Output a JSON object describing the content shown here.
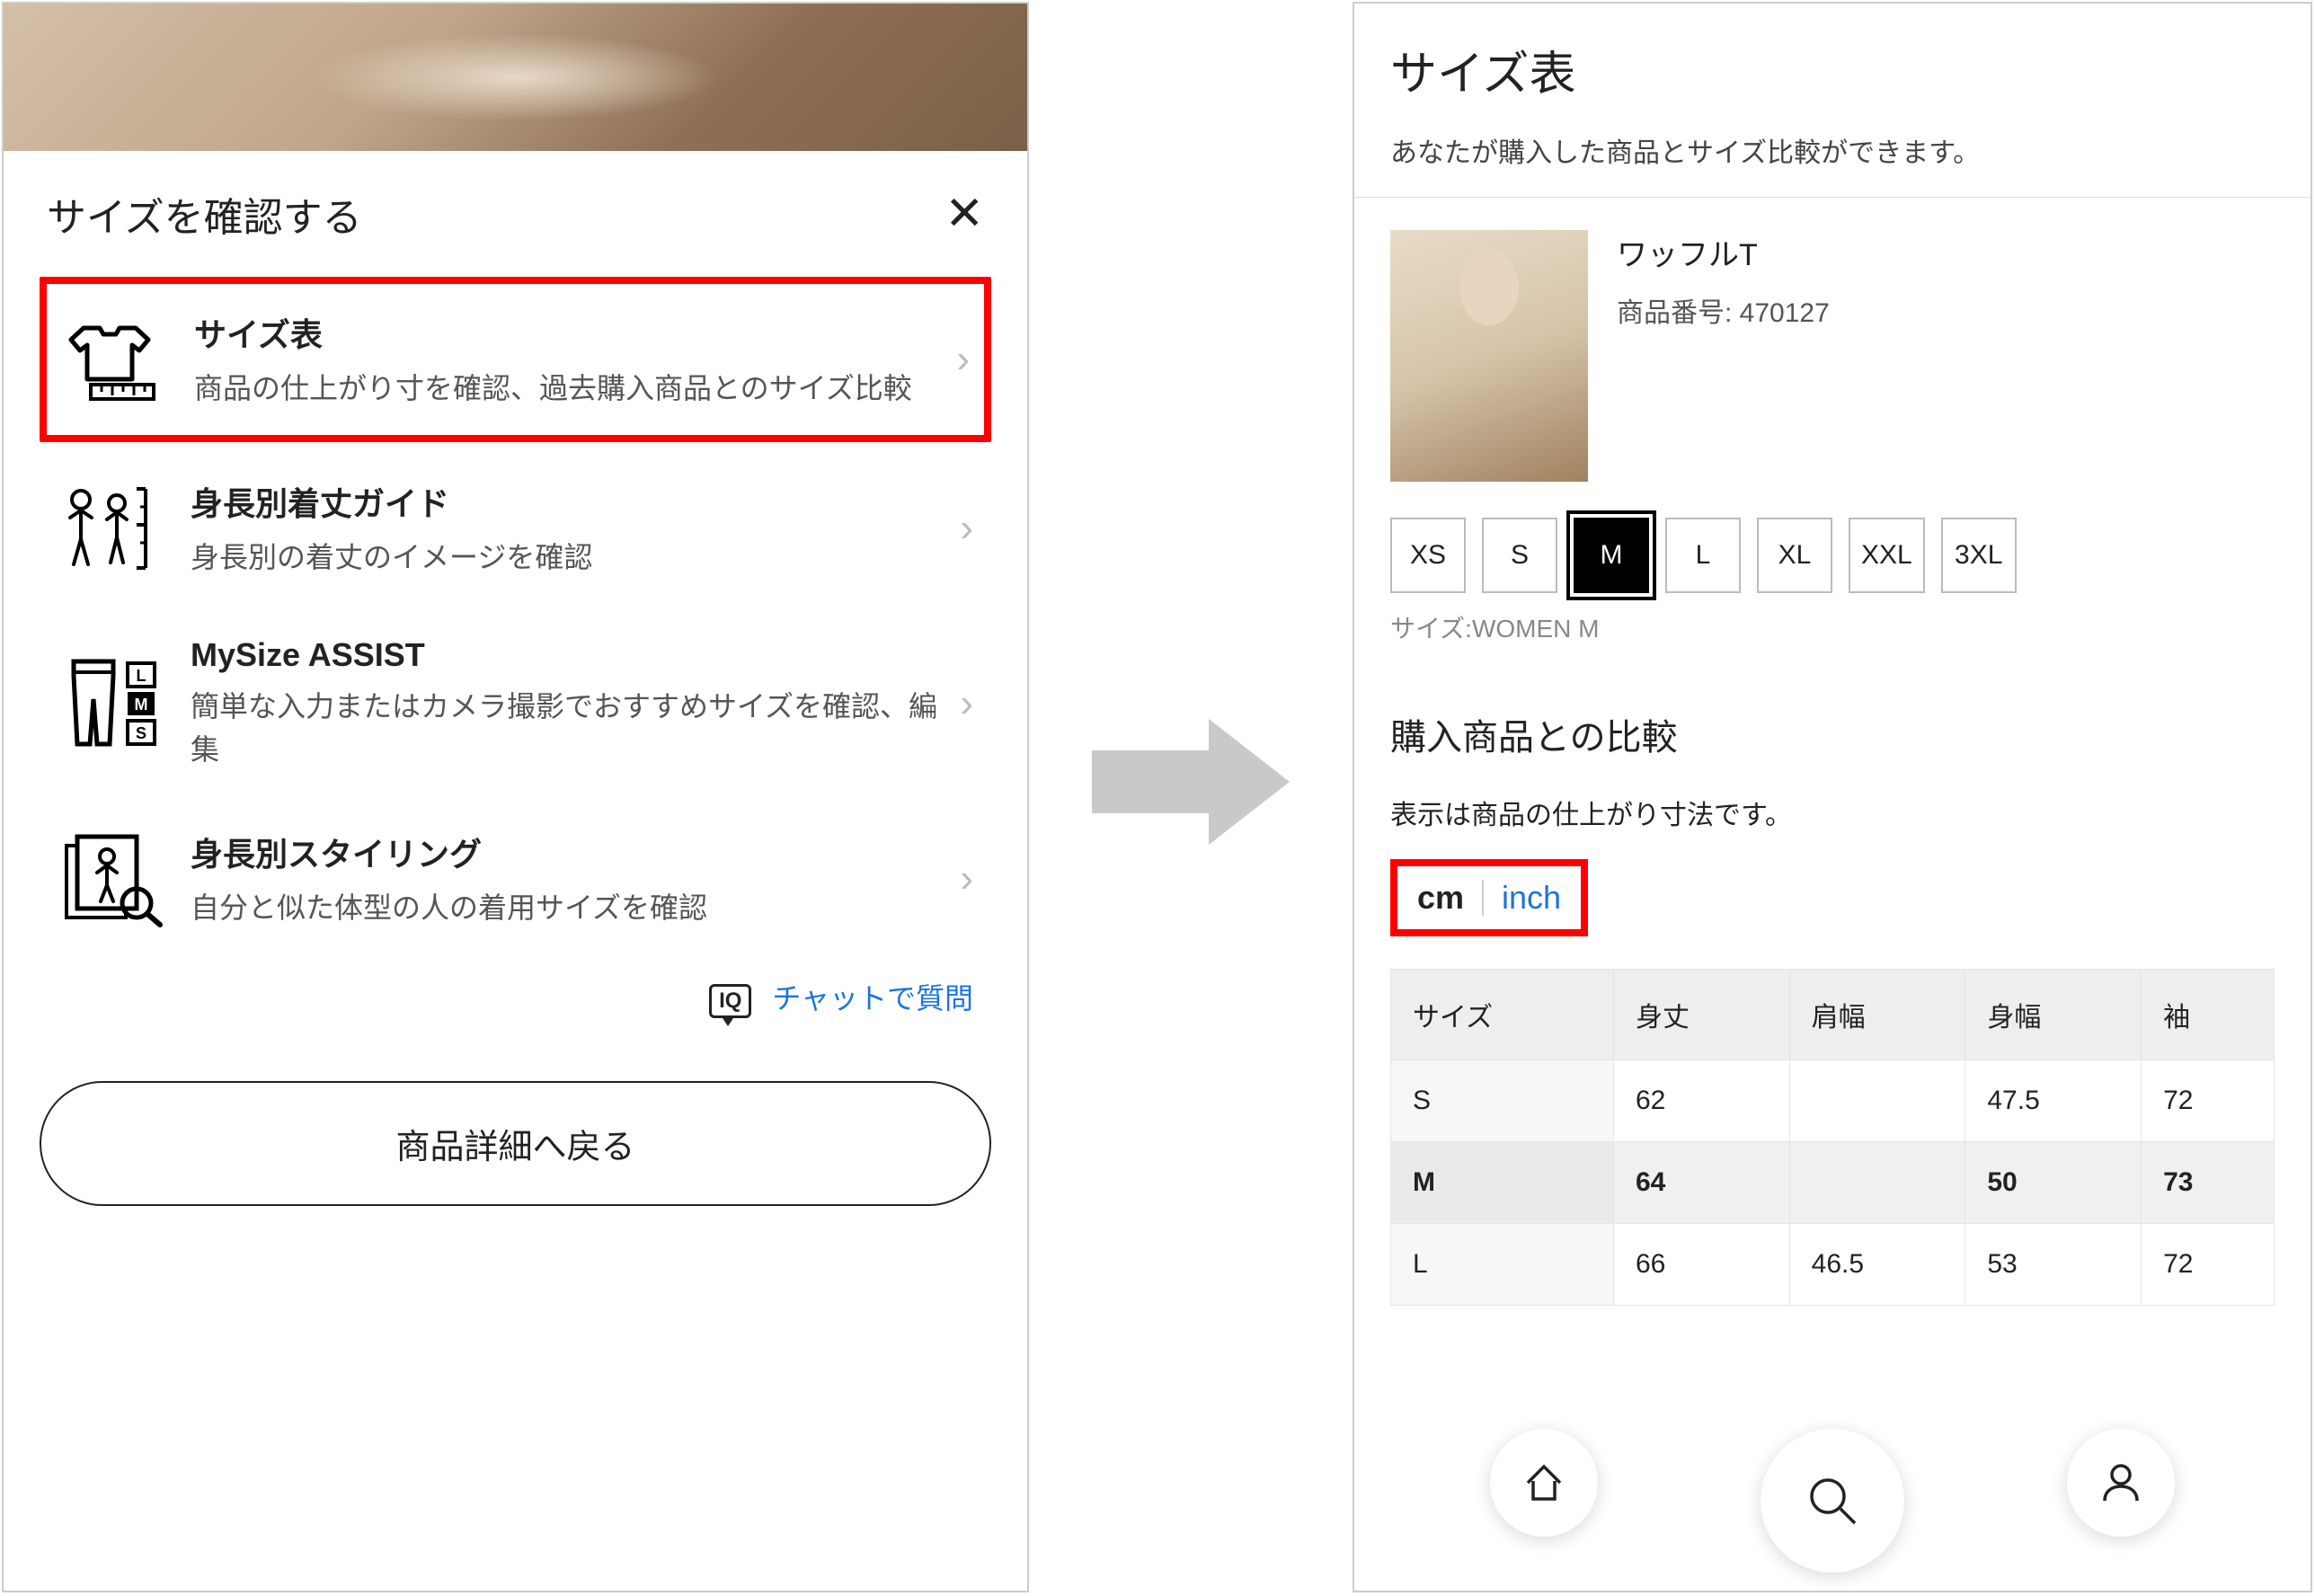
{
  "left": {
    "title": "サイズを確認する",
    "options": [
      {
        "title": "サイズ表",
        "desc": "商品の仕上がり寸を確認、過去購入商品とのサイズ比較"
      },
      {
        "title": "身長別着丈ガイド",
        "desc": "身長別の着丈のイメージを確認"
      },
      {
        "title": "MySize ASSIST",
        "desc": "簡単な入力またはカメラ撮影でおすすめサイズを確認、編集"
      },
      {
        "title": "身長別スタイリング",
        "desc": "自分と似た体型の人の着用サイズを確認"
      }
    ],
    "chat_iq": "IQ",
    "chat_link": "チャットで質問",
    "back_btn": "商品詳細へ戻る"
  },
  "right": {
    "title": "サイズ表",
    "subtitle": "あなたが購入した商品とサイズ比較ができます。",
    "product_name": "ワッフルT",
    "product_code_label": "商品番号: 470127",
    "sizes": [
      "XS",
      "S",
      "M",
      "L",
      "XL",
      "XXL",
      "3XL"
    ],
    "selected_size": "M",
    "size_label_prefix": "サイズ:WOMEN M",
    "compare_title": "購入商品との比較",
    "compare_note": "表示は商品の仕上がり寸法です。",
    "unit_cm": "cm",
    "unit_inch": "inch",
    "table": {
      "headers": [
        "サイズ",
        "身丈",
        "肩幅",
        "身幅",
        "袖"
      ],
      "rows": [
        {
          "size": "S",
          "v": [
            "62",
            "",
            "47.5",
            "72"
          ]
        },
        {
          "size": "M",
          "v": [
            "64",
            "",
            "50",
            "73"
          ],
          "selected": true
        },
        {
          "size": "L",
          "v": [
            "66",
            "46.5",
            "53",
            "72"
          ]
        }
      ]
    }
  }
}
